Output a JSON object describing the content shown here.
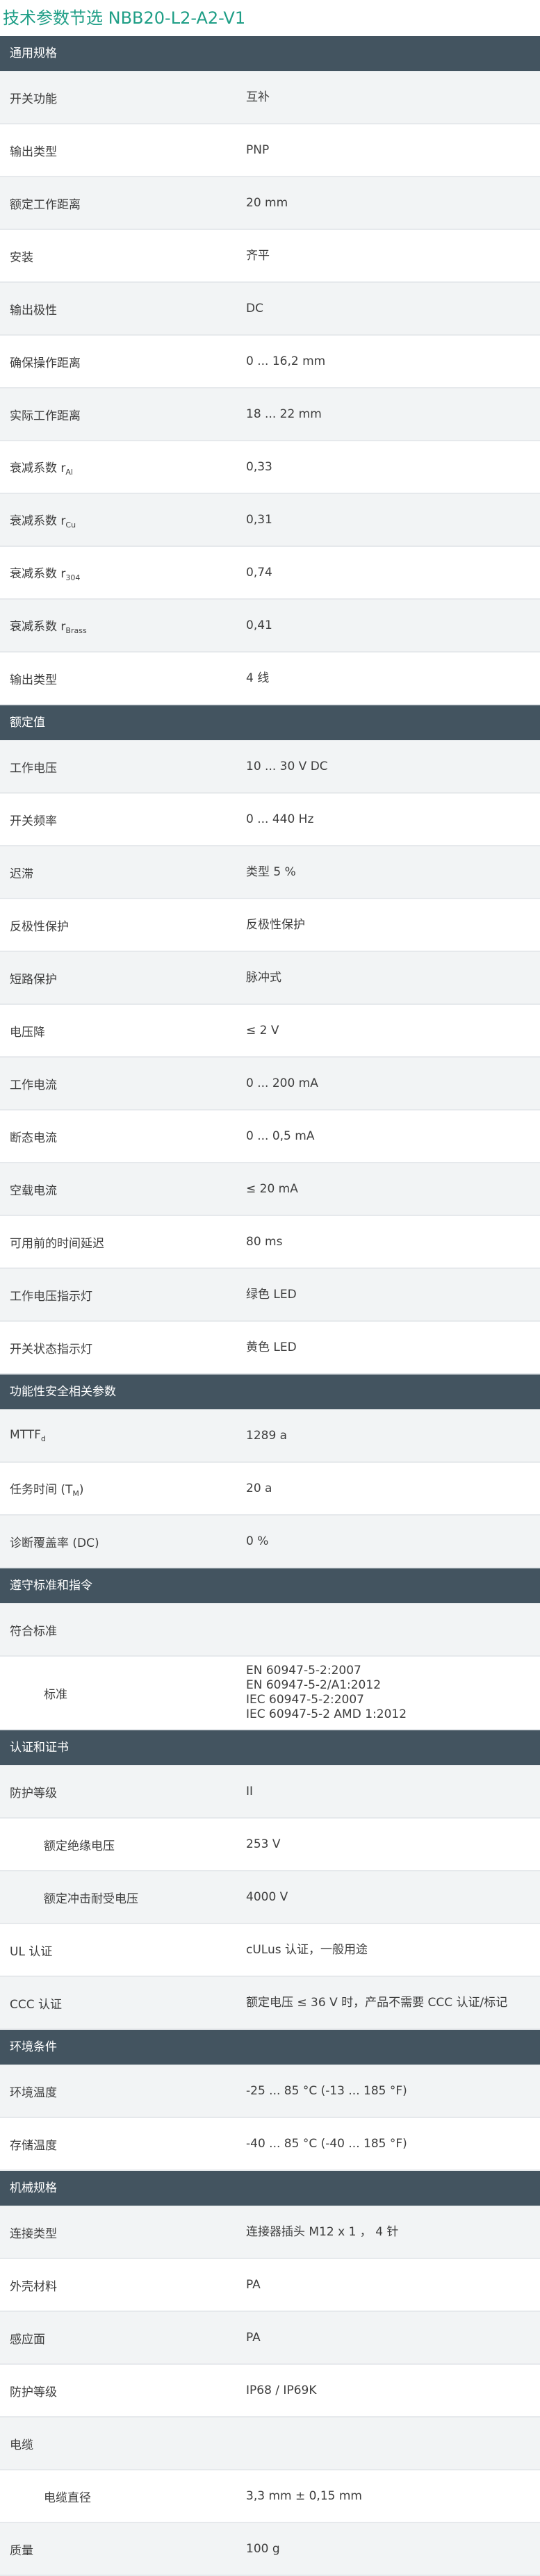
{
  "page_title": "技术参数节选  NBB20-L2-A2-V1",
  "sections": [
    {
      "title": "通用规格",
      "rows": [
        {
          "label": "开关功能",
          "value": "互补"
        },
        {
          "label": "输出类型",
          "value": "PNP"
        },
        {
          "label": "额定工作距离",
          "value": "20 mm"
        },
        {
          "label": "安装",
          "value": "齐平"
        },
        {
          "label": "输出极性",
          "value": "DC"
        },
        {
          "label": "确保操作距离",
          "value": "0 ... 16,2 mm"
        },
        {
          "label": "实际工作距离",
          "value": "18 ... 22 mm"
        },
        {
          "label": "衰减系数 r",
          "sub": "Al",
          "value": "0,33"
        },
        {
          "label": "衰减系数 r",
          "sub": "Cu",
          "value": "0,31"
        },
        {
          "label": "衰减系数 r",
          "sub": "304",
          "value": "0,74"
        },
        {
          "label": "衰减系数 r",
          "sub": "Brass",
          "value": "0,41"
        },
        {
          "label": "输出类型",
          "value": "4 线"
        }
      ]
    },
    {
      "title": "额定值",
      "rows": [
        {
          "label": "工作电压",
          "value": "10 ... 30 V DC"
        },
        {
          "label": "开关频率",
          "value": "0 ... 440 Hz"
        },
        {
          "label": "迟滞",
          "value": "类型 5 %"
        },
        {
          "label": "反极性保护",
          "value": "反极性保护"
        },
        {
          "label": "短路保护",
          "value": "脉冲式"
        },
        {
          "label": "电压降",
          "value": "≤ 2 V"
        },
        {
          "label": "工作电流",
          "value": "0 ... 200 mA"
        },
        {
          "label": "断态电流",
          "value": "0 ... 0,5 mA"
        },
        {
          "label": "空载电流",
          "value": "≤ 20 mA"
        },
        {
          "label": "可用前的时间延迟",
          "value": "80 ms"
        },
        {
          "label": "工作电压指示灯",
          "value": "绿色 LED"
        },
        {
          "label": "开关状态指示灯",
          "value": "黄色 LED"
        }
      ]
    },
    {
      "title": "功能性安全相关参数",
      "rows": [
        {
          "label": "MTTF",
          "sub": "d",
          "value": "1289 a"
        },
        {
          "label": "任务时间 (T",
          "sub": "M",
          "after": ")",
          "value": "20 a"
        },
        {
          "label": "诊断覆盖率 (DC)",
          "value": "0 %"
        }
      ]
    },
    {
      "title": "遵守标准和指令",
      "rows": [
        {
          "label": "符合标准",
          "value": ""
        },
        {
          "label": "标准",
          "indent": true,
          "tall": true,
          "value": "EN 60947-5-2:2007\nEN 60947-5-2/A1:2012\nIEC 60947-5-2:2007\nIEC 60947-5-2 AMD 1:2012"
        }
      ]
    },
    {
      "title": "认证和证书",
      "rows": [
        {
          "label": "防护等级",
          "value": "II"
        },
        {
          "label": "额定绝缘电压",
          "indent": true,
          "value": "253 V"
        },
        {
          "label": "额定冲击耐受电压",
          "indent": true,
          "value": "4000 V"
        },
        {
          "label": "UL 认证",
          "value": "cULus 认证，一般用途"
        },
        {
          "label": "CCC 认证",
          "value": "额定电压 ≤ 36 V 时，产品不需要 CCC 认证/标记"
        }
      ]
    },
    {
      "title": "环境条件",
      "rows": [
        {
          "label": "环境温度",
          "value": "-25 ... 85 °C (-13 ... 185 °F)"
        },
        {
          "label": "存储温度",
          "value": "-40 ... 85 °C (-40 ... 185 °F)"
        }
      ]
    },
    {
      "title": "机械规格",
      "rows": [
        {
          "label": "连接类型",
          "value": "连接器插头 M12 x 1 ，  4 针"
        },
        {
          "label": "外壳材料",
          "value": "PA"
        },
        {
          "label": "感应面",
          "value": "PA"
        },
        {
          "label": "防护等级",
          "value": "IP68 / IP69K"
        },
        {
          "label": "电缆",
          "value": ""
        },
        {
          "label": "电缆直径",
          "indent": true,
          "value": "3,3 mm ± 0,15 mm"
        },
        {
          "label": "质量",
          "value": "100 g"
        }
      ]
    }
  ]
}
